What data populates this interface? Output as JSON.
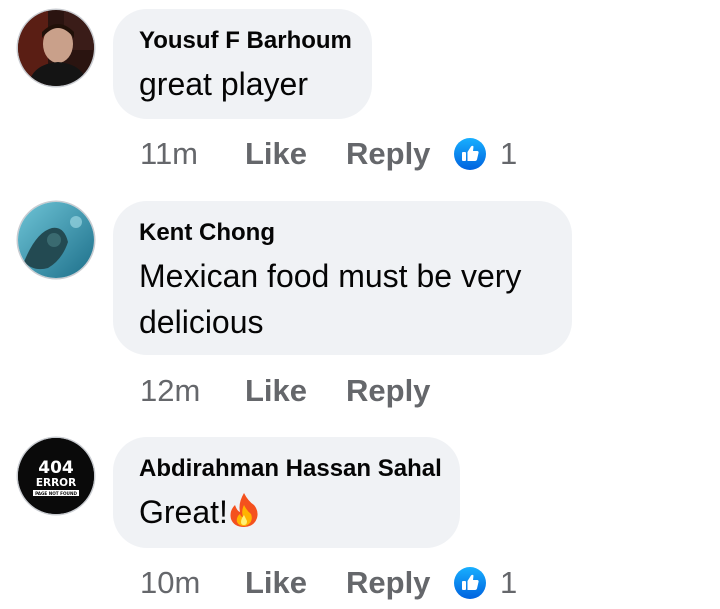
{
  "comments": [
    {
      "author": "Yousuf F Barhoum",
      "text": "great player",
      "time": "11m",
      "like_label": "Like",
      "reply_label": "Reply",
      "reaction_icon": "like-thumb-icon",
      "reaction_count": "1"
    },
    {
      "author": "Kent Chong",
      "text_line1": "Mexican food must be very",
      "text_line2": "delicious",
      "time": "12m",
      "like_label": "Like",
      "reply_label": "Reply"
    },
    {
      "author": "Abdirahman Hassan Sahal",
      "text": "Great!",
      "emoji": "fire-icon",
      "time": "10m",
      "like_label": "Like",
      "reply_label": "Reply",
      "reaction_icon": "like-thumb-icon",
      "reaction_count": "1",
      "avatar_text": {
        "code": "404",
        "label": "ERROR",
        "sub": "PAGE NOT FOUND"
      }
    }
  ],
  "colors": {
    "bubble_bg": "#f0f2f5",
    "text": "#050505",
    "secondary_text": "#65676b",
    "like_blue": "#1877f2"
  }
}
